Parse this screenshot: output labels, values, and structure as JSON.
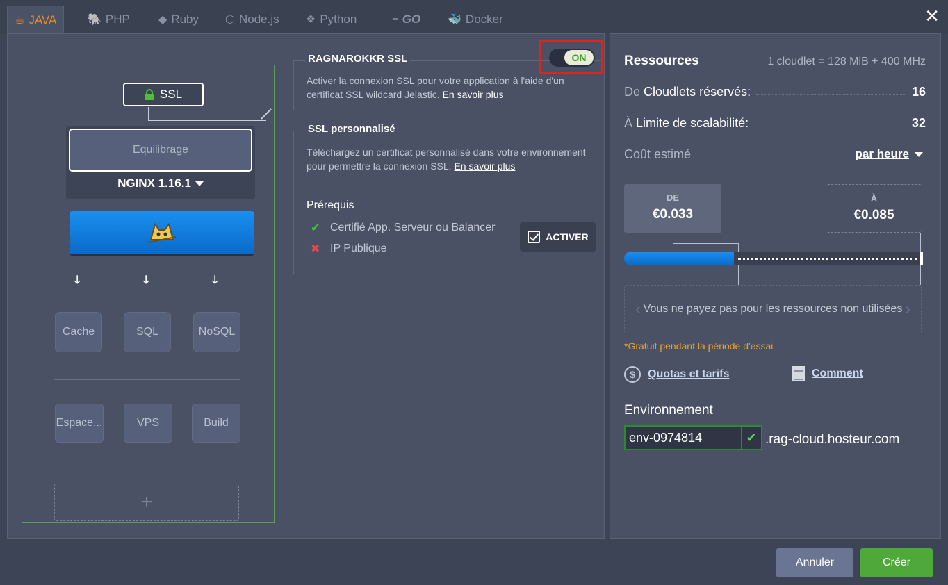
{
  "tabs": [
    {
      "label": "JAVA",
      "icon": "java-icon"
    },
    {
      "label": "PHP",
      "icon": "php-icon"
    },
    {
      "label": "Ruby",
      "icon": "ruby-icon"
    },
    {
      "label": "Node.js",
      "icon": "nodejs-icon"
    },
    {
      "label": "Python",
      "icon": "python-icon"
    },
    {
      "label": "GO",
      "icon": "go-icon"
    },
    {
      "label": "Docker",
      "icon": "docker-icon"
    }
  ],
  "topology": {
    "ssl_label": "SSL",
    "balancer_label": "Equilibrage",
    "balancer_version": "NGINX 1.16.1",
    "nodes": [
      "Cache",
      "SQL",
      "NoSQL"
    ],
    "extras": [
      "Espace...",
      "VPS",
      "Build"
    ],
    "add_label": "+"
  },
  "ssl": {
    "title": "RAGNAROKKR SSL",
    "toggle": "ON",
    "text": "Activer la connexion SSL pour votre application à l'aide d'un certificat SSL wildcard Jelastic.",
    "link": "En savoir plus"
  },
  "custom_ssl": {
    "title": "SSL personnalisé",
    "text": "Téléchargez un certificat personnalisé dans votre environnement pour permettre la connexion SSL.",
    "link": "En savoir plus",
    "prereq_title": "Prérequis",
    "prereqs": [
      "Certifié App. Serveur ou Balancer",
      "IP Publique"
    ],
    "activate_label": "ACTIVER"
  },
  "resources": {
    "title": "Ressources",
    "cloudlet_info": "1 cloudlet = 128 MiB + 400 MHz",
    "reserved_prefix": "De",
    "reserved_label": "Cloudlets réservés:",
    "reserved_value": "16",
    "scale_prefix": "À",
    "scale_label": "Limite de scalabilité:",
    "scale_value": "32",
    "cost_label": "Coût estimé",
    "cost_period": "par heure",
    "from_label": "DE",
    "from_value": "€0.033",
    "to_label": "À",
    "to_value": "€0.085",
    "fill_fraction": 0.37,
    "free_text": "Vous ne payez pas pour les ressources non utilisées",
    "trial_text": "*Gratuit pendant la période d'essai",
    "quotas_link": "Quotas et tarifs",
    "how_link": "Comment"
  },
  "environment": {
    "label": "Environnement",
    "value": "env-0974814",
    "domain": ".rag-cloud.hosteur.com"
  },
  "buttons": {
    "cancel": "Annuler",
    "create": "Créer"
  },
  "colors": {
    "accent_orange": "#f08a24",
    "primary_blue": "#0a6ac9",
    "success_green": "#4ea83a",
    "highlight_red": "#e2231a"
  }
}
